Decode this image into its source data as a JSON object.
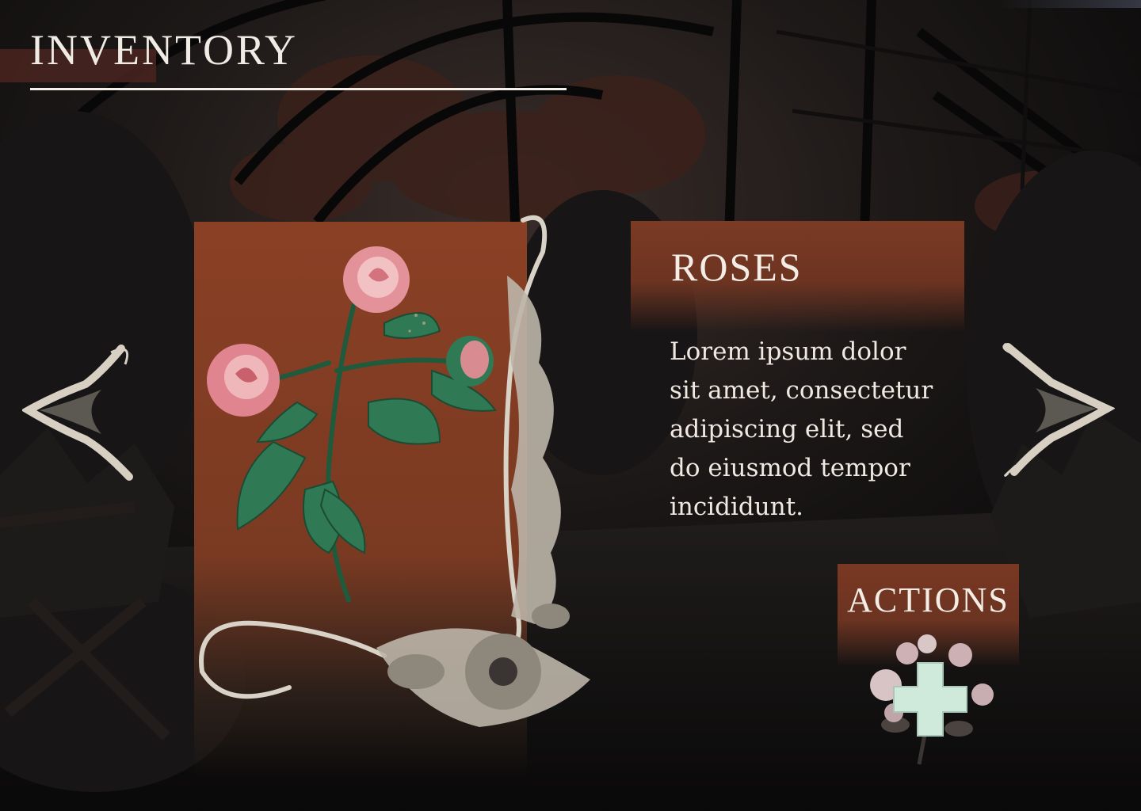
{
  "screen": {
    "title": "INVENTORY"
  },
  "item": {
    "name": "ROSES",
    "description": "Lorem ipsum dolor\nsit amet, consectetur\nadipiscing elit, sed\ndo eiusmod  tempor\nincididunt.",
    "art_icon": "rose-bouquet-icon"
  },
  "actions": {
    "label": "ACTIONS",
    "icon": "rose-plus-icon"
  },
  "navigation": {
    "prev_icon": "arrow-left-icon",
    "next_icon": "arrow-right-icon"
  },
  "colors": {
    "panel": "#7b3a24",
    "text": "#f0ebe4",
    "background": "#1a1716",
    "leaf": "#2f7a55",
    "rose": "#e3929a"
  }
}
